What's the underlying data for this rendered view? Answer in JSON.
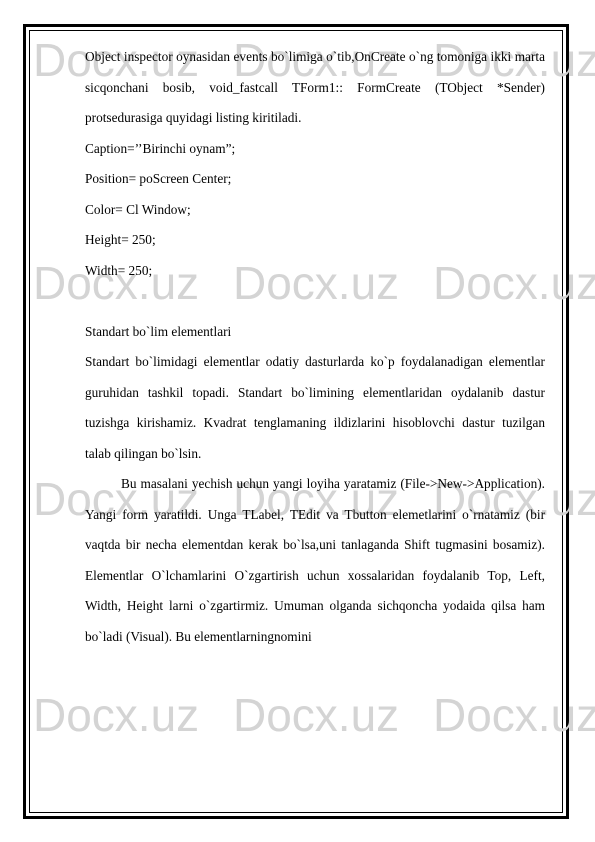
{
  "watermark": {
    "text": "Docx.uz"
  },
  "document": {
    "paragraph_intro": "Object inspector oynasidan events bo`limiga o`tib,OnCreate o`ng tomoniga ikki marta sicqonchani bosib, void_fastcall TForm1:: FormCreate (TObject *Sender) protsedurasiga quyidagi listing kiritiladi.",
    "code_lines": [
      "Caption=’’Birinchi oynam”;",
      "Position= poScreen Center;",
      "Color= Cl Window;",
      "Height= 250;",
      "Width= 250;"
    ],
    "section_heading": "Standart bo`lim elementlari",
    "paragraph_standard": "Standart bo`limidagi elementlar odatiy dasturlarda ko`p foydalanadigan elementlar guruhidan tashkil topadi. Standart bo`limining elementlaridan oydalanib dastur tuzishga kirishamiz. Kvadrat tenglamaning ildizlarini hisoblovchi dastur tuzilgan talab qilingan bo`lsin.",
    "paragraph_task": "Bu masalani yechish uchun yangi loyiha yaratamiz (File->New->Application). Yangi form yaratildi. Unga TLabel, TEdit va Tbutton elemetlarini o`rnatamiz (bir vaqtda bir necha elementdan kerak bo`lsa,uni tanlaganda Shift tugmasini bosamiz). Elementlar O`lchamlarini O`zgartirish uchun xossalaridan foydalanib Top, Left, Width, Height larni o`zgartirmiz. Umuman olganda sichqoncha yodaida qilsa ham bo`ladi (Visual). Bu elementlarningnomini"
  }
}
